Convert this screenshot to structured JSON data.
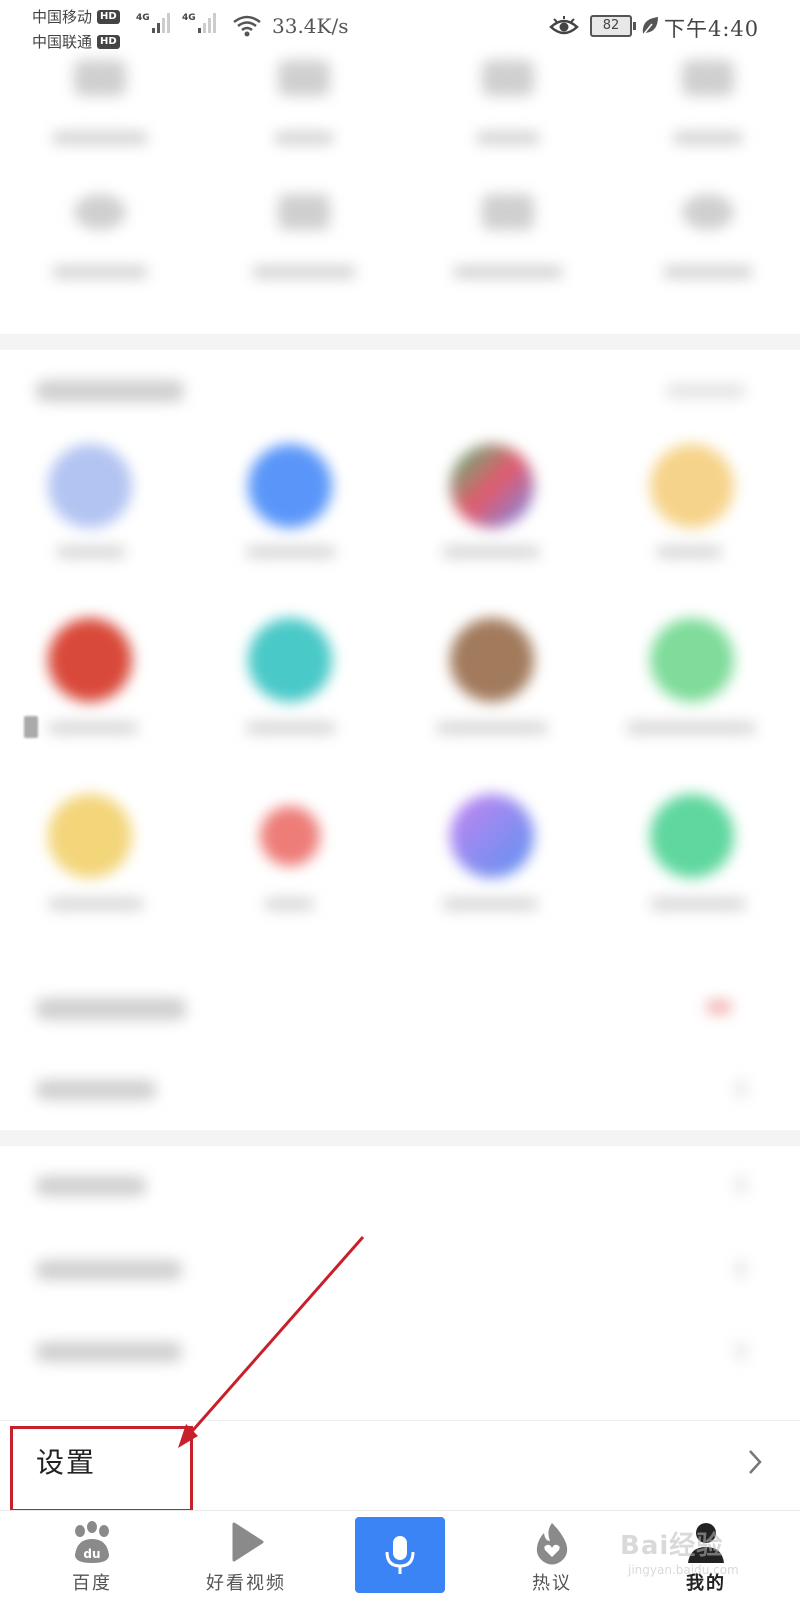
{
  "status_bar": {
    "carrier_1": "中国移动",
    "carrier_2": "中国联通",
    "hd_badge": "HD",
    "network_tag": "4G",
    "net_speed": "33.4K/s",
    "battery_level": "82",
    "time": "下午4:40"
  },
  "settings": {
    "label": "设置"
  },
  "bottom_nav": {
    "items": [
      {
        "label": "百度",
        "icon": "baidu-paw-icon"
      },
      {
        "label": "好看视频",
        "icon": "play-icon"
      },
      {
        "label": "",
        "icon": "microphone-icon"
      },
      {
        "label": "热议",
        "icon": "flame-heart-icon"
      },
      {
        "label": "我的",
        "icon": "person-icon"
      }
    ],
    "active_index": 4
  },
  "watermark": {
    "text": "Bai经验",
    "sub": "jingyan.baidu.com"
  },
  "colors": {
    "accent_blue": "#3a84f6",
    "annotation_red": "#c8202a"
  }
}
